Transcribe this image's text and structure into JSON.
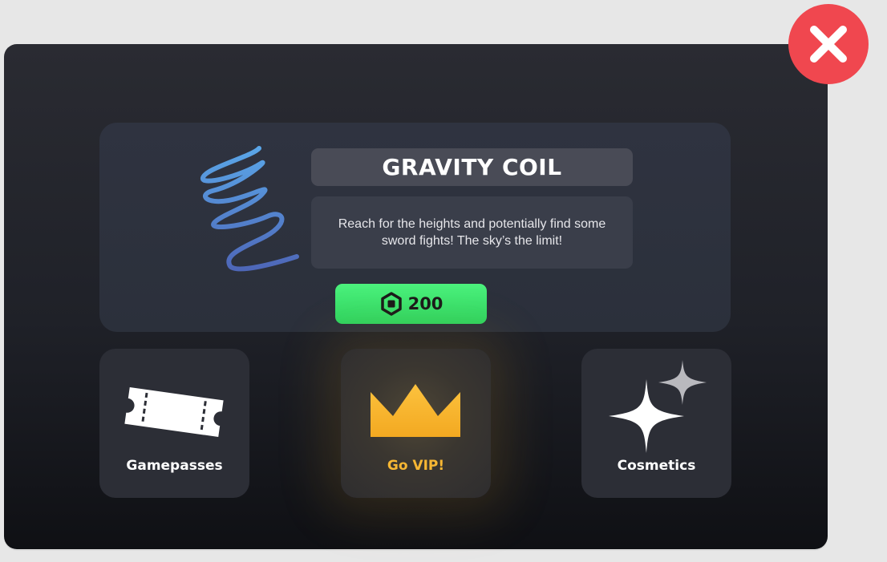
{
  "item": {
    "name": "GRAVITY COIL",
    "description": "Reach for the heights and potentially find some sword fights! The sky’s the limit!",
    "price": "200",
    "currency_icon": "robux-icon"
  },
  "nav": {
    "gamepasses_label": "Gamepasses",
    "vip_label": "Go VIP!",
    "cosmetics_label": "Cosmetics"
  },
  "colors": {
    "close": "#f0474f",
    "buy": "#33dd66",
    "vip_accent": "#f7b733"
  }
}
